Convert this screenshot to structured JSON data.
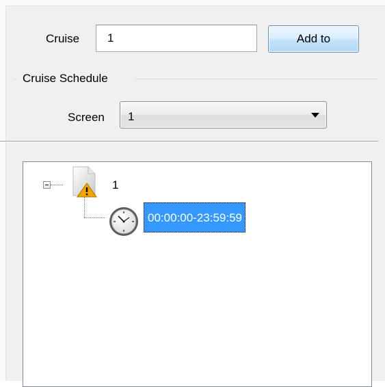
{
  "cruise": {
    "label": "Cruise",
    "value": "1",
    "add_button_label": "Add to"
  },
  "schedule": {
    "group_label": "Cruise Schedule",
    "screen_label": "Screen",
    "screen_value": "1"
  },
  "tree": {
    "root": {
      "label": "1",
      "icon": "warning-document-icon",
      "expanded": true,
      "children": [
        {
          "icon": "clock-icon",
          "label": "00:00:00-23:59:59",
          "selected": true
        }
      ]
    }
  },
  "colors": {
    "selection": "#3399ff",
    "button_gradient_top": "#eaf5fd",
    "button_gradient_bottom": "#b2d8f6",
    "warning": "#f2a400"
  }
}
